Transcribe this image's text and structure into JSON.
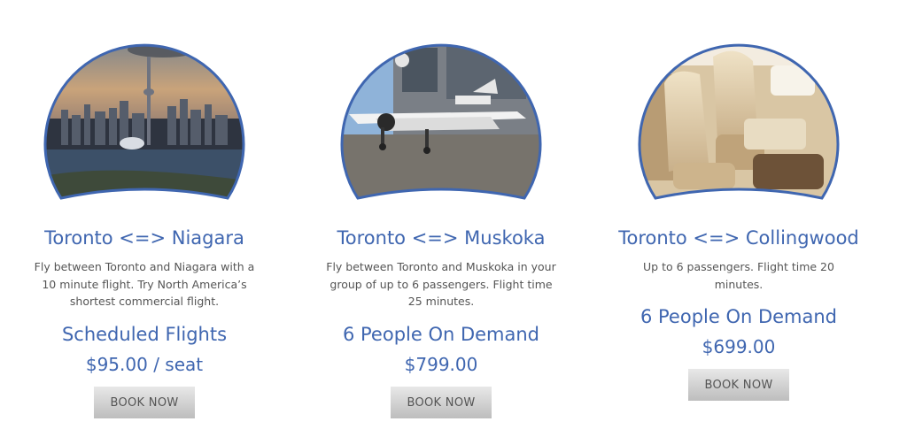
{
  "cards": [
    {
      "route": "Toronto <=> Niagara",
      "description": "Fly between Toronto and Niagara with a 10 minute flight. Try North America’s shortest commercial flight.",
      "service": "Scheduled Flights",
      "price": "$95.00 / seat",
      "button": "BOOK NOW",
      "image": "toronto-skyline-photo"
    },
    {
      "route": "Toronto <=> Muskoka",
      "description": "Fly between Toronto and Muskoka in your group of up to 6 passengers. Flight time 25 minutes.",
      "service": "6 People On Demand",
      "price": "$799.00",
      "button": "BOOK NOW",
      "image": "airplane-photo"
    },
    {
      "route": "Toronto <=> Collingwood",
      "description": "Up to 6 passengers. Flight time 20 minutes.",
      "service": "6 People On Demand",
      "price": "$699.00",
      "button": "BOOK NOW",
      "image": "cabin-interior-photo"
    }
  ],
  "colors": {
    "accent": "#3f66b0",
    "body_text": "#555555",
    "button_top": "#e8e8e8",
    "button_bottom": "#bdbdbd"
  }
}
